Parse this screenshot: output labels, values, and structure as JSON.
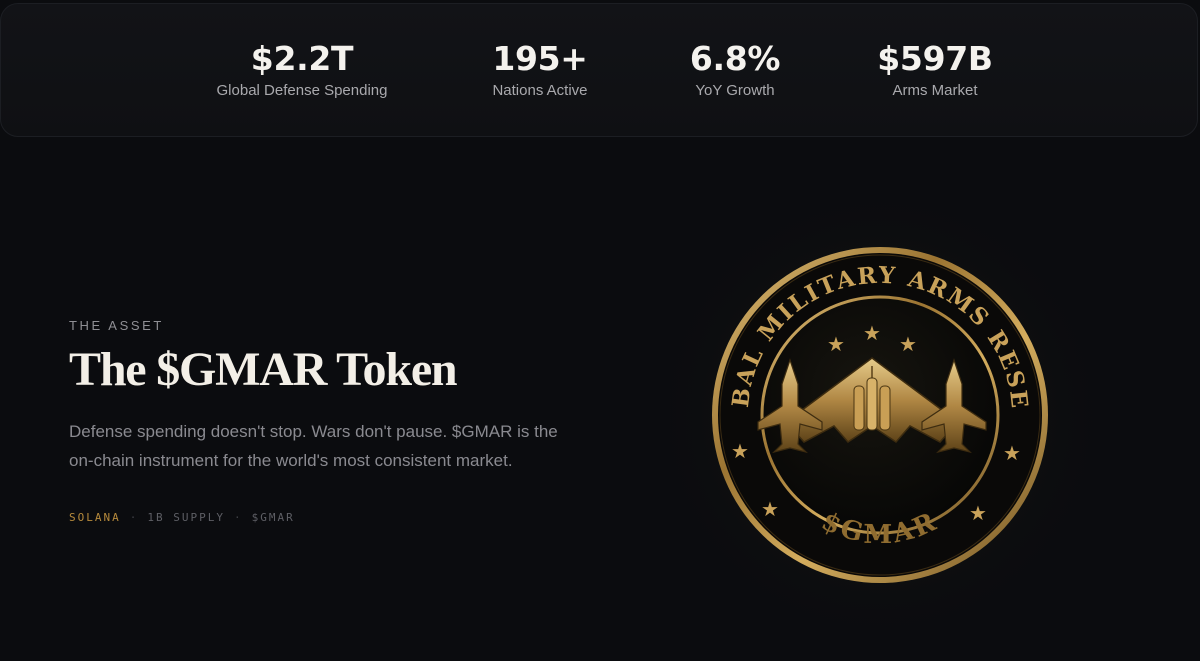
{
  "stats": [
    {
      "value": "$2.2T",
      "label": "Global Defense Spending"
    },
    {
      "value": "195+",
      "label": "Nations Active"
    },
    {
      "value": "6.8%",
      "label": "YoY Growth"
    },
    {
      "value": "$597B",
      "label": "Arms Market"
    }
  ],
  "asset": {
    "eyebrow": "THE ASSET",
    "title": "The $GMAR Token",
    "description": "Defense spending doesn't stop. Wars don't pause. $GMAR is the on-chain instrument for the world's most consistent market.",
    "meta": {
      "chain": "SOLANA",
      "separator": "·",
      "supply": "1B SUPPLY",
      "ticker": "$GMAR"
    }
  },
  "coin": {
    "ring_text": "GLOBAL MILITARY ARMS RESERVE",
    "ticker": "$GMAR",
    "star": "★"
  },
  "colors": {
    "background": "#0b0c0f",
    "gold": "#b68a3c",
    "gold_light": "#d9b56a",
    "gold_dark": "#6b4d1e"
  }
}
